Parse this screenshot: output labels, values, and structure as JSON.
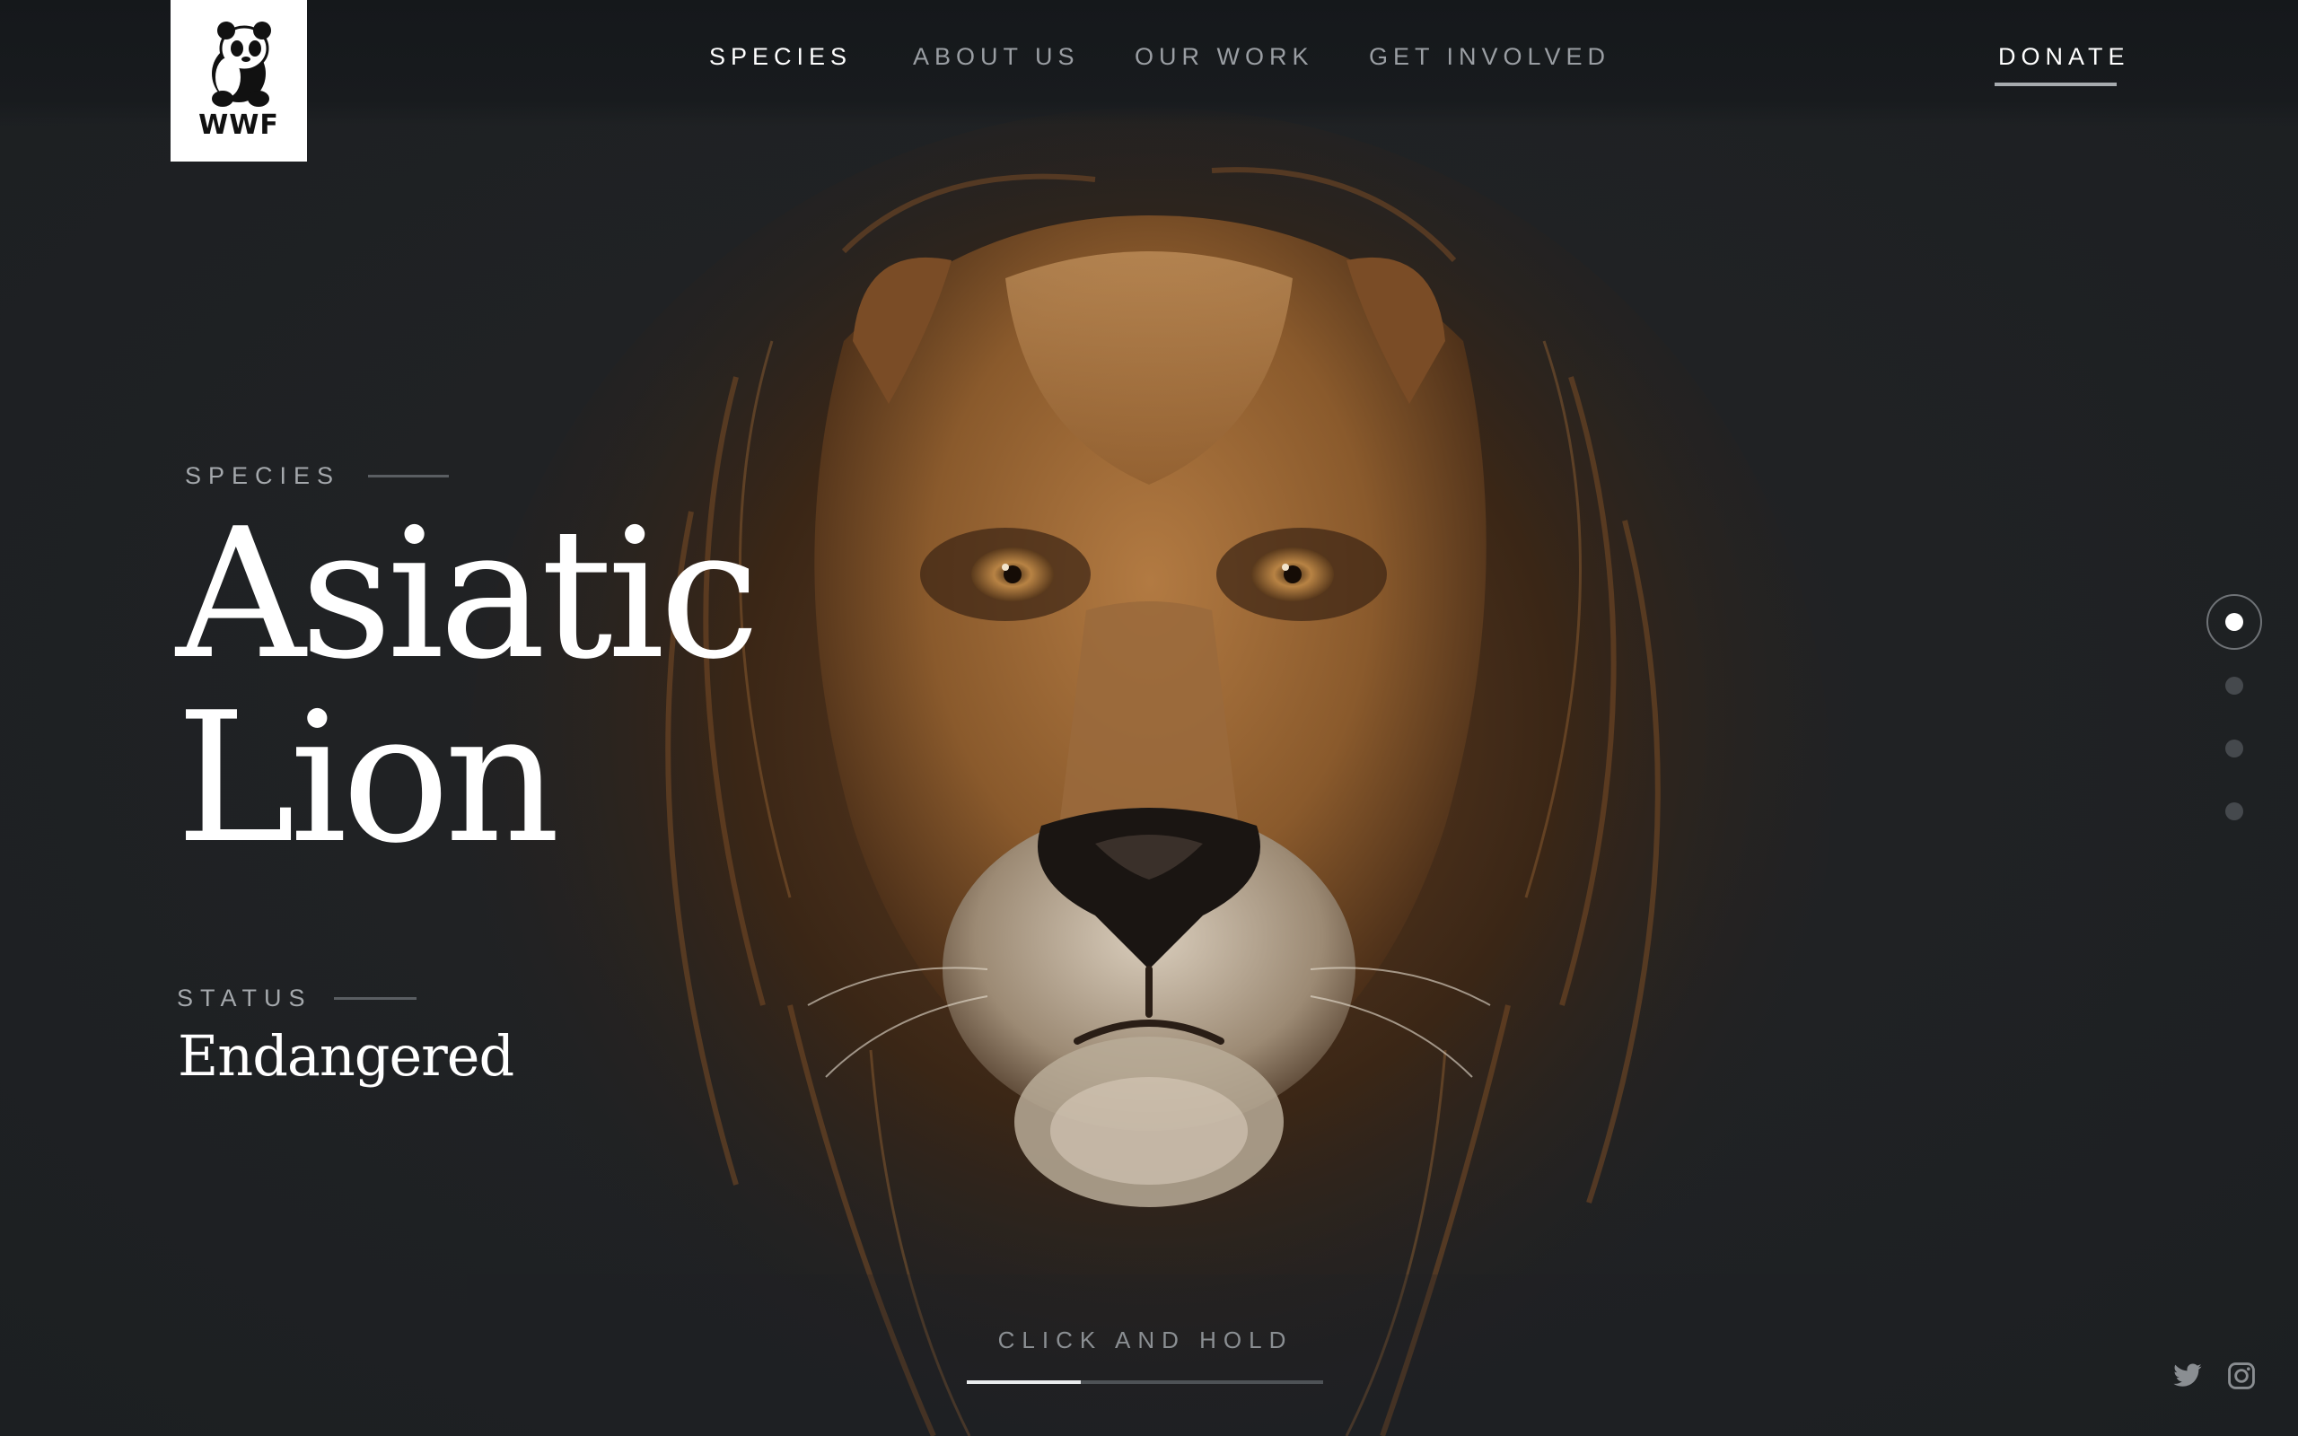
{
  "brand": {
    "logo_text": "WWF",
    "logo_icon": "panda-icon"
  },
  "nav": {
    "items": [
      {
        "label": "SPECIES",
        "active": true
      },
      {
        "label": "ABOUT US",
        "active": false
      },
      {
        "label": "OUR WORK",
        "active": false
      },
      {
        "label": "GET INVOLVED",
        "active": false
      }
    ],
    "donate_label": "DONATE"
  },
  "hero": {
    "eyebrow": "SPECIES",
    "title_line1": "Asiatic",
    "title_line2": "Lion",
    "status_label": "STATUS",
    "status_value": "Endangered",
    "image_subject": "lion-face-illustration"
  },
  "pager": {
    "count": 4,
    "active_index": 0
  },
  "hold": {
    "label": "CLICK AND HOLD",
    "progress": 0.32
  },
  "social": {
    "icons": [
      "twitter-icon",
      "instagram-icon"
    ]
  },
  "colors": {
    "background": "#1e2124",
    "text_primary": "#ffffff",
    "text_muted": "#9a9ea3",
    "mane_dark": "#3a2616",
    "mane_mid": "#6b4322",
    "fur_gold": "#a06a34",
    "fur_light": "#c89a66"
  }
}
